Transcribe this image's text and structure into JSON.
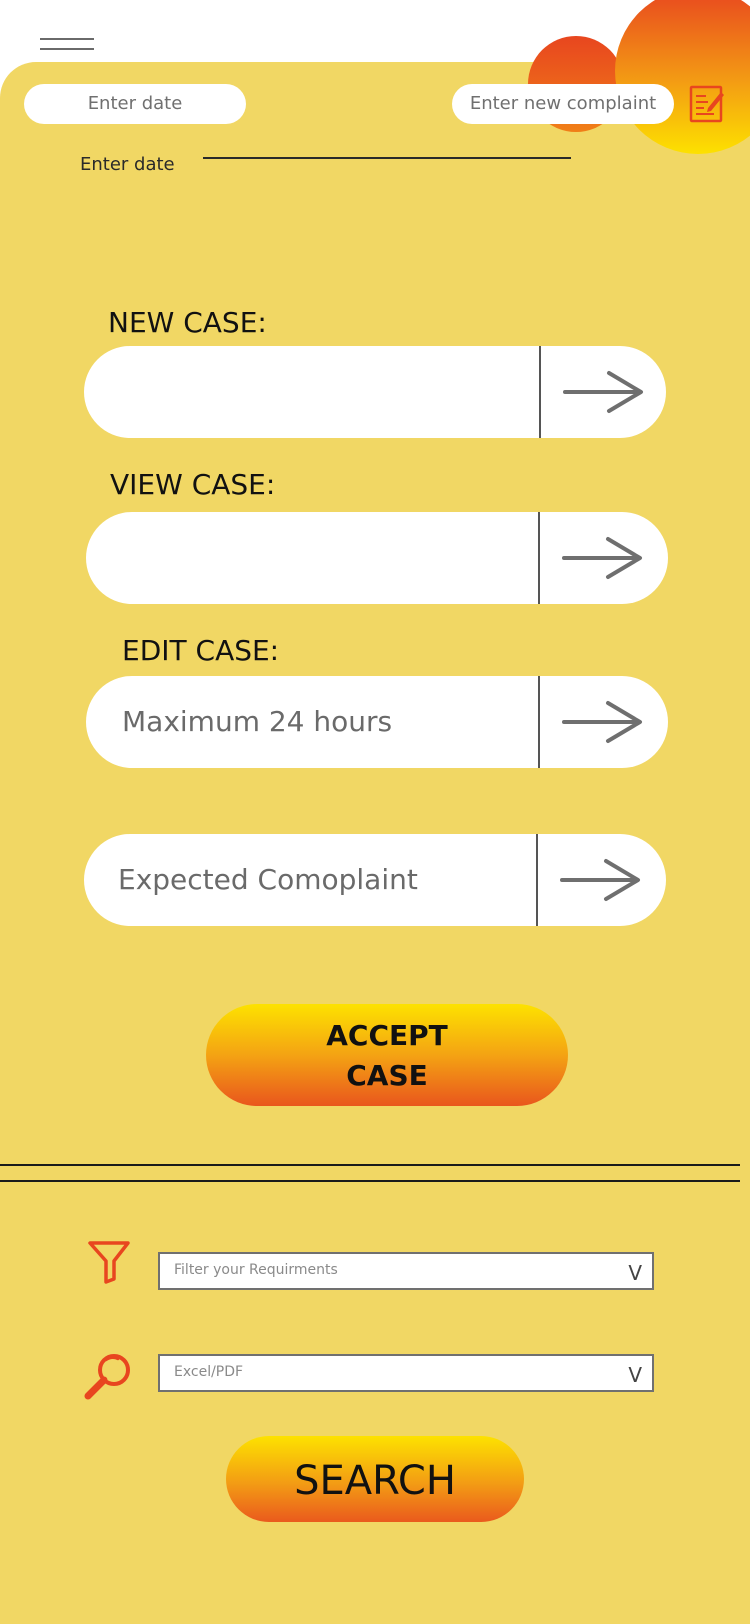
{
  "header": {
    "date_placeholder": "Enter date",
    "complaint_placeholder": "Enter new complaint",
    "date_label": "Enter date"
  },
  "cases": {
    "new_label": "NEW CASE:",
    "new_value": "",
    "view_label": "VIEW CASE:",
    "view_value": "",
    "edit_label": "EDIT CASE:",
    "edit_value": "Maximum 24 hours",
    "expected_value": "Expected Comoplaint"
  },
  "accept_button": {
    "line1": "ACCEPT",
    "line2": "CASE"
  },
  "filters": {
    "requirements_placeholder": "Filter your Requirments",
    "format_placeholder": "Excel/PDF",
    "chevron": "V"
  },
  "search_button": {
    "label": "SEARCH"
  },
  "icons": {
    "menu": "hamburger-icon",
    "note": "edit-note-icon",
    "arrow": "arrow-right-icon",
    "filter": "funnel-icon",
    "search": "magnifier-icon"
  },
  "colors": {
    "panel": "#f1d764",
    "accent_orange": "#e8461f",
    "accent_yellow": "#fde200",
    "arrow_gray": "#6f6f6f"
  }
}
